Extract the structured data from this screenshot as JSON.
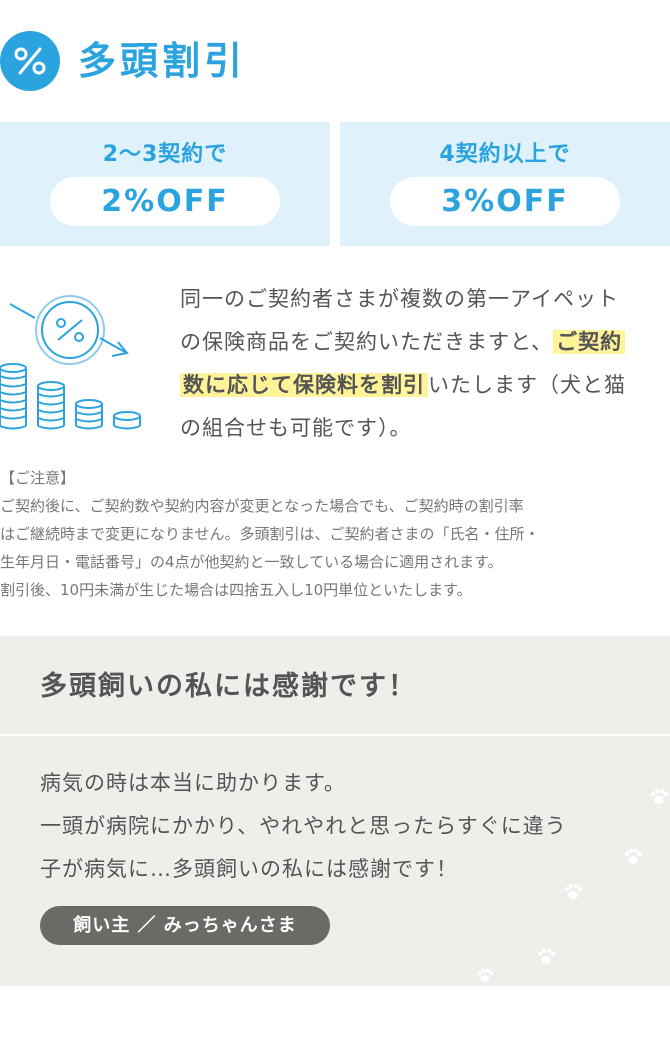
{
  "header": {
    "icon": "percent-icon",
    "title": "多頭割引"
  },
  "discounts": [
    {
      "condition": "2〜3契約で",
      "rate": "2%OFF"
    },
    {
      "condition": "4契約以上で",
      "rate": "3%OFF"
    }
  ],
  "illustration": {
    "icon": "coins-decreasing-icon"
  },
  "description": {
    "part1": "同一のご契約者さまが複数の第一アイペット",
    "part2": "の保険商品をご契約いただきますと、",
    "highlight1": "ご契約",
    "highlight2": "数に応じて保険料を割引",
    "part3": "いたします（犬と猫",
    "part4": "の組合せも可能です）。"
  },
  "notice": {
    "heading": "【ご注意】",
    "lines": [
      "ご契約後に、ご契約数や契約内容が変更となった場合でも、ご契約時の割引率",
      "はご継続時まで変更になりません。多頭割引は、ご契約者さまの「氏名・住所・",
      "生年月日・電話番号」の4点が他契約と一致している場合に適用されます。",
      "割引後、10円未満が生じた場合は四捨五入し10円単位といたします。"
    ]
  },
  "testimonial": {
    "title": "多頭飼いの私には感謝です！",
    "lines": [
      "病気の時は本当に助かります。",
      "一頭が病院にかかり、やれやれと思ったらすぐに違う",
      "子が病気に…多頭飼いの私には感謝です！"
    ],
    "author": "飼い主 ／ みっちゃんさま",
    "decoration_icon": "paw-print-icon"
  },
  "colors": {
    "accent": "#2ba3de",
    "box_bg": "#dff1fb",
    "highlight": "#fff39a",
    "testimonial_bg": "#efeeeb",
    "author_pill": "#6b6a66"
  }
}
